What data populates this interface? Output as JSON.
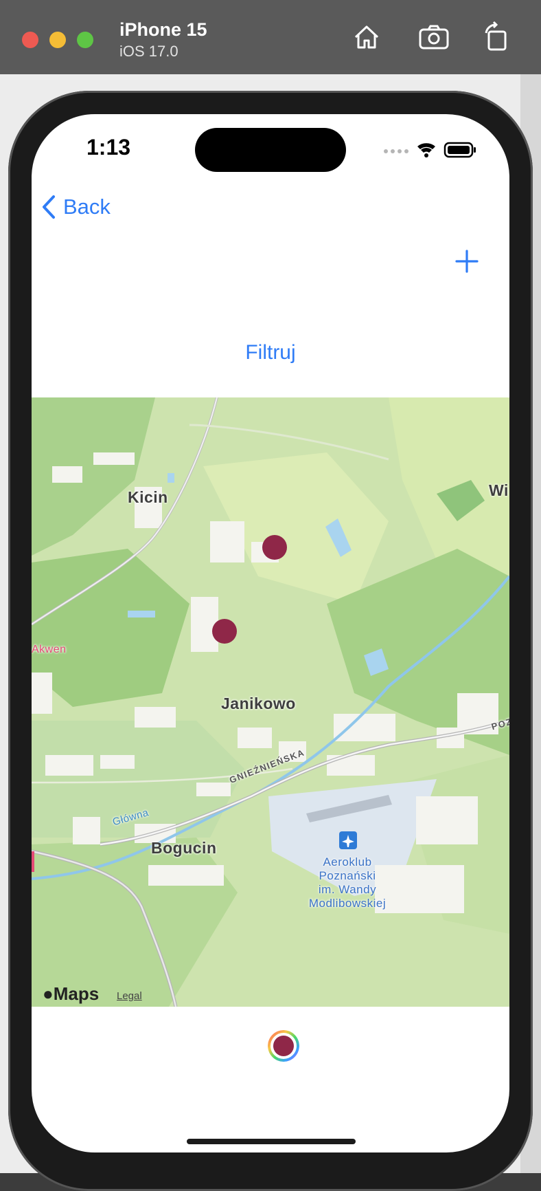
{
  "simulator": {
    "device_name": "iPhone 15",
    "os_version": "iOS 17.0",
    "controls": [
      "home-icon",
      "screenshot-icon",
      "rotate-icon"
    ]
  },
  "status_bar": {
    "time": "1:13"
  },
  "nav": {
    "back_label": "Back",
    "add_icon": "plus-icon"
  },
  "filter_label": "Filtruj",
  "map": {
    "labels": {
      "kicin": "Kicin",
      "wi": "Wi",
      "akwen": "Akwen",
      "janikowo": "Janikowo",
      "gnieznienska": "GNIEŹNIEŃSKA",
      "glowna": "Główna",
      "poz": "POZ",
      "bogucin": "Bogucin",
      "airport": [
        "Aeroklub",
        "Poznański",
        "im. Wandy",
        "Modlibowskiej"
      ]
    },
    "attribution": "Maps",
    "legal": "Legal",
    "pin_color": "#8f2748"
  },
  "colors": {
    "accent": "#2f7cf6"
  }
}
